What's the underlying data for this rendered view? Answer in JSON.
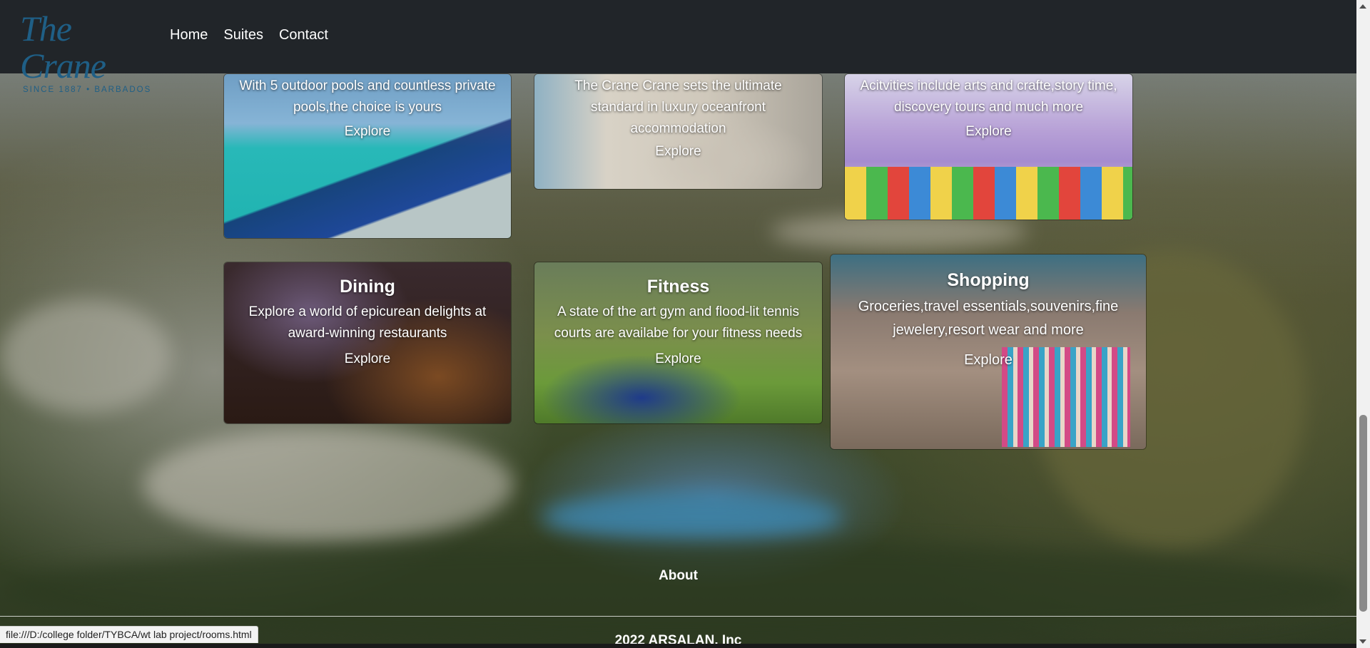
{
  "brand": {
    "name": "The Crane",
    "tagline": "SINCE 1887 • BARBADOS"
  },
  "nav": {
    "items": [
      {
        "label": "Home"
      },
      {
        "label": "Suites"
      },
      {
        "label": "Contact"
      }
    ]
  },
  "cards": {
    "pools": {
      "title": "",
      "text": "With 5 outdoor pools and countless private pools,the choice is yours",
      "button": "Explore"
    },
    "suites": {
      "title": "",
      "text": "The Crane Crane sets the ultimate standard in luxury oceanfront accommodation",
      "button": "Explore"
    },
    "kids": {
      "title": "",
      "text": "Acitvities include arts and crafte,story time, discovery tours and much more",
      "button": "Explore"
    },
    "dining": {
      "title": "Dining",
      "text": "Explore a world of epicurean delights at award-winning restaurants",
      "button": "Explore"
    },
    "fitness": {
      "title": "Fitness",
      "text": "A state of the art gym and flood-lit tennis courts are availabe for your fitness needs",
      "button": "Explore"
    },
    "shopping": {
      "title": "Shopping",
      "text": "Groceries,travel essentials,souvenirs,fine jewelery,resort wear and more",
      "button": "Explore"
    }
  },
  "footer": {
    "about": "About",
    "copyright": "2022 ARSALAN. Inc"
  },
  "status_bar": {
    "url": "file:///D:/college folder/TYBCA/wt lab project/rooms.html"
  },
  "colors": {
    "navbar": "#212529",
    "logo": "#1f5f86"
  }
}
